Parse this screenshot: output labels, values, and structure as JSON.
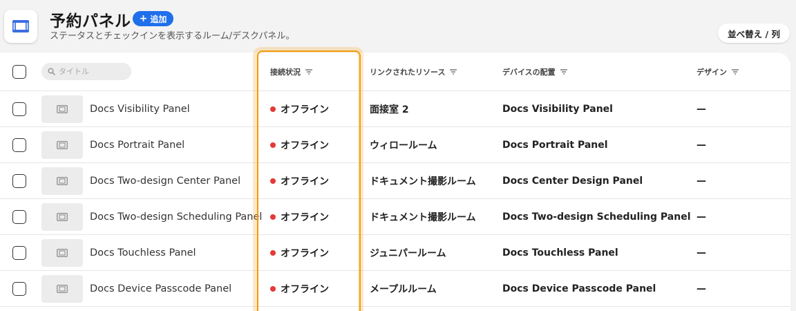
{
  "header": {
    "title": "予約パネル",
    "add_label": "追加",
    "subtitle": "ステータスとチェックインを表示するルーム/デスクパネル。",
    "sort_label": "並べ替え / 列",
    "icon": "panel-icon"
  },
  "table": {
    "search_placeholder": "タイトル",
    "columns": {
      "status": "接続状況",
      "resource": "リンクされたリソース",
      "device": "デバイスの配置",
      "design": "デザイン"
    },
    "rows": [
      {
        "title": "Docs Visibility Panel",
        "status": "オフライン",
        "resource": "面接室 2",
        "device": "Docs Visibility Panel",
        "design": "—"
      },
      {
        "title": "Docs Portrait Panel",
        "status": "オフライン",
        "resource": "ウィロールーム",
        "device": "Docs Portrait Panel",
        "design": "—"
      },
      {
        "title": "Docs Two-design Center Panel",
        "status": "オフライン",
        "resource": "ドキュメント撮影ルーム",
        "device": "Docs Center Design Panel",
        "design": "—"
      },
      {
        "title": "Docs Two-design Scheduling Panel",
        "status": "オフライン",
        "resource": "ドキュメント撮影ルーム",
        "device": "Docs Two-design Scheduling Panel",
        "design": "—"
      },
      {
        "title": "Docs Touchless Panel",
        "status": "オフライン",
        "resource": "ジュニパールーム",
        "device": "Docs Touchless Panel",
        "design": "—"
      },
      {
        "title": "Docs Device Passcode Panel",
        "status": "オフライン",
        "resource": "メープルルーム",
        "device": "Docs Device Passcode Panel",
        "design": "—"
      }
    ]
  },
  "colors": {
    "accent": "#1f6feb",
    "offline": "#e53935",
    "highlight": "#f39c12"
  }
}
